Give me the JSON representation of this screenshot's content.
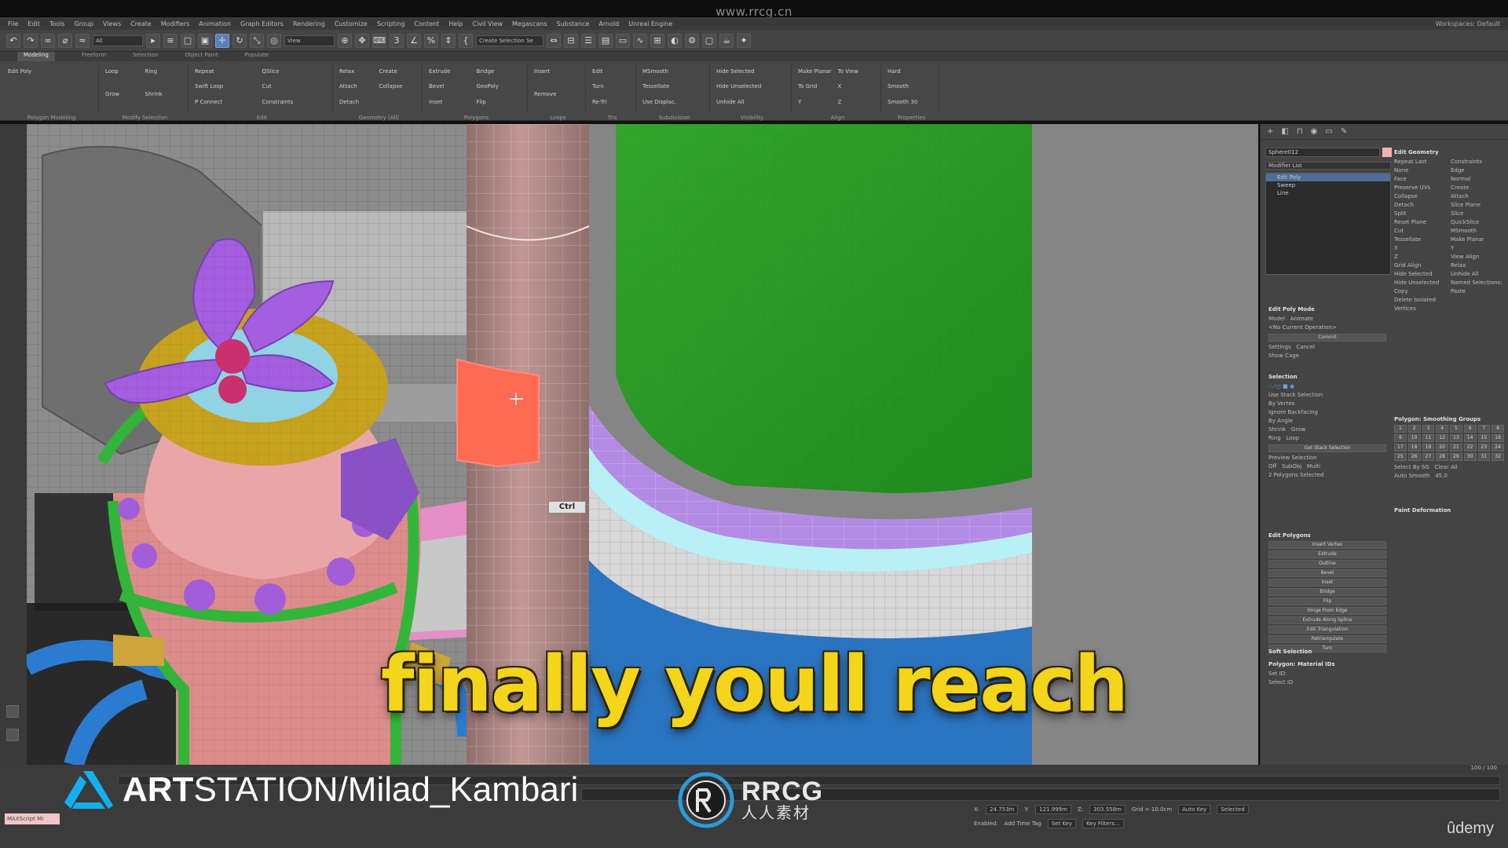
{
  "watermark_top": "www.rrcg.cn",
  "menu": {
    "items": [
      "File",
      "Edit",
      "Tools",
      "Group",
      "Views",
      "Create",
      "Modifiers",
      "Animation",
      "Graph Editors",
      "Rendering",
      "Customize",
      "Scripting",
      "Content",
      "Help",
      "Civil View",
      "Megascans",
      "Substance",
      "Arnold",
      "Unreal Engine"
    ],
    "workspace_label": "Workspaces:",
    "workspace_value": "Default"
  },
  "toolbar": {
    "selection_filter": "All",
    "ref_coord": "View",
    "named_set": "Create Selection Se"
  },
  "ribbon": {
    "tabs": [
      "Modeling",
      "Freeform",
      "Selection",
      "Object Paint",
      "Populate"
    ],
    "groups": [
      {
        "label": "Polygon Modeling",
        "items": [
          "Edit Poly"
        ]
      },
      {
        "label": "Modify Selection",
        "items": [
          "Loop",
          "Ring",
          "Grow",
          "Shrink"
        ]
      },
      {
        "label": "Edit",
        "items": [
          "Repeat",
          "QSlice",
          "Swift Loop",
          "Cut",
          "P Connect",
          "Constraints"
        ]
      },
      {
        "label": "Geometry (All)",
        "items": [
          "Relax",
          "Create",
          "Attach",
          "Collapse",
          "Detach"
        ]
      },
      {
        "label": "Polygons",
        "items": [
          "Extrude",
          "Bridge",
          "Bevel",
          "GeoPoly",
          "Inset",
          "Flip"
        ]
      },
      {
        "label": "Loops",
        "items": [
          "Insert",
          "Remove"
        ]
      },
      {
        "label": "Tris",
        "items": [
          "Edit",
          "Turn",
          "Re-Tri"
        ]
      },
      {
        "label": "Subdivision",
        "items": [
          "MSmooth",
          "Tessellate",
          "Use Displac."
        ]
      },
      {
        "label": "Visibility",
        "items": [
          "Hide Selected",
          "Hide Unselected",
          "Unhide All"
        ]
      },
      {
        "label": "Align",
        "items": [
          "Make Planar",
          "To View",
          "To Grid",
          "X",
          "Y",
          "Z"
        ]
      },
      {
        "label": "Properties",
        "items": [
          "Hard",
          "Smooth",
          "Smooth 30"
        ]
      }
    ]
  },
  "command_panel": {
    "object_name": "Sphere012",
    "modifier_list": "Modifier List",
    "stack": [
      "Edit Poly",
      "Sweep",
      "Line"
    ],
    "edit_poly_mode": {
      "title": "Edit Poly Mode",
      "model": "Model",
      "animate": "Animate",
      "current_op": "<No Current Operation>",
      "commit": "Commit",
      "settings": "Settings",
      "cancel": "Cancel",
      "show_cage": "Show Cage"
    },
    "selection": {
      "title": "Selection",
      "use_stack": "Use Stack Selection",
      "by_vertex": "By Vertex",
      "ignore_backfacing": "Ignore Backfacing",
      "by_angle": "By Angle",
      "shrink": "Shrink",
      "grow": "Grow",
      "ring": "Ring",
      "loop": "Loop",
      "get_stack_selection": "Get Stack Selection",
      "preview_selection": "Preview Selection",
      "off": "Off",
      "subobj": "SubObj",
      "multi": "Multi",
      "status": "2 Polygons Selected"
    },
    "edit_polygons": {
      "title": "Edit Polygons",
      "items": [
        "Insert Vertex",
        "Extrude",
        "Outline",
        "Bevel",
        "Inset",
        "Bridge",
        "Flip",
        "Hinge From Edge",
        "Extrude Along Spline",
        "Edit Triangulation",
        "Retriangulate",
        "Turn"
      ]
    },
    "soft_selection": "Soft Selection",
    "material_ids": {
      "title": "Polygon: Material IDs",
      "set_id": "Set ID:",
      "select_id": "Select ID"
    },
    "edit_geometry": {
      "title": "Edit Geometry",
      "items": [
        "Repeat Last",
        "Constraints",
        "None",
        "Edge",
        "Face",
        "Normal",
        "Preserve UVs",
        "Create",
        "Collapse",
        "Attach",
        "Detach",
        "Slice Plane",
        "Split",
        "Slice",
        "Reset Plane",
        "QuickSlice",
        "Cut",
        "MSmooth",
        "Tessellate",
        "Make Planar",
        "X",
        "Y",
        "Z",
        "View Align",
        "Grid Align",
        "Relax",
        "Hide Selected",
        "Unhide All",
        "Hide Unselected",
        "Named Selections:",
        "Copy",
        "Paste",
        "Delete Isolated Vertices"
      ]
    },
    "smoothing_groups": {
      "title": "Polygon: Smoothing Groups",
      "numbers": [
        "1",
        "2",
        "3",
        "4",
        "5",
        "6",
        "7",
        "8",
        "9",
        "10",
        "11",
        "12",
        "13",
        "14",
        "15",
        "16",
        "17",
        "18",
        "19",
        "20",
        "21",
        "22",
        "23",
        "24",
        "25",
        "26",
        "27",
        "28",
        "29",
        "30",
        "31",
        "32"
      ],
      "select_by_sg": "Select By SG",
      "clear_all": "Clear All",
      "auto_smooth": "Auto Smooth",
      "auto_smooth_value": "45.0"
    },
    "paint_deformation": "Paint Deformation"
  },
  "viewport": {
    "ctrl_badge": "Ctrl"
  },
  "status": {
    "maxscript_label": "MAXScript Mi",
    "frame_counter": "100 / 100",
    "x_label": "X:",
    "x_value": "24.753m",
    "y_label": "Y:",
    "y_value": "121.999m",
    "z_label": "Z:",
    "z_value": "303.558m",
    "grid": "Grid = 10.0cm",
    "auto_key": "Auto Key",
    "selected": "Selected",
    "set_key": "Set Key",
    "key_filters": "Key Filters...",
    "add_time_tag": "Add Time Tag",
    "enabled": "Enabled:"
  },
  "overlay": {
    "subtitle": "finally youll reach",
    "credit_bold": "ART",
    "credit_rest": "STATION/Milad_Kambari",
    "rrcg_big": "RRCG",
    "rrcg_small": "人人素材",
    "udemy": "ûdemy"
  },
  "colors": {
    "subtitle": "#f3d51b",
    "green_object": "#2f9b2a",
    "purple_trim": "#b48ae8",
    "selected_polys": "#ff6a55",
    "column": "#b28b87",
    "artstation_blue": "#13aff0"
  }
}
